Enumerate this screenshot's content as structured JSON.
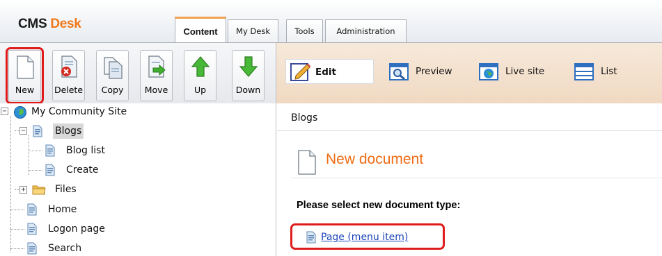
{
  "header": {
    "logo_brand": "CMS",
    "logo_product": "Desk",
    "tabs": [
      {
        "label": "Content",
        "active": true
      },
      {
        "label": "My Desk",
        "active": false
      },
      {
        "label": "Tools",
        "active": false
      },
      {
        "label": "Administration",
        "active": false
      }
    ]
  },
  "toolbar_left": {
    "buttons": [
      {
        "label": "New",
        "icon": "new-document-icon",
        "highlighted": true
      },
      {
        "label": "Delete",
        "icon": "delete-document-icon"
      },
      {
        "label": "Copy",
        "icon": "copy-document-icon"
      },
      {
        "label": "Move",
        "icon": "move-document-icon"
      },
      {
        "label": "Up",
        "icon": "arrow-up-icon"
      },
      {
        "label": "Down",
        "icon": "arrow-down-icon"
      }
    ]
  },
  "toolbar_right": {
    "modes": [
      {
        "label": "Edit",
        "icon": "edit-pencil-icon",
        "active": true
      },
      {
        "label": "Preview",
        "icon": "preview-magnifier-icon"
      },
      {
        "label": "Live site",
        "icon": "globe-icon"
      },
      {
        "label": "List",
        "icon": "list-icon"
      }
    ]
  },
  "tree": {
    "root": "My Community Site",
    "nodes": [
      {
        "label": "Blogs",
        "selected": true,
        "expander": "-"
      },
      {
        "label": "Blog list"
      },
      {
        "label": "Create"
      },
      {
        "label": "Files",
        "expander": "+"
      },
      {
        "label": "Home"
      },
      {
        "label": "Logon page"
      },
      {
        "label": "Search"
      }
    ]
  },
  "content": {
    "breadcrumb": "Blogs",
    "title": "New document",
    "prompt": "Please select new document type:",
    "doc_types": [
      {
        "label": "Page (menu item)",
        "highlighted": true
      }
    ]
  },
  "colors": {
    "accent_orange": "#ef6c14",
    "highlight_red": "#e01b1b",
    "link_blue": "#1a44b8",
    "right_toolbar_bg": "#f2dfcb"
  }
}
